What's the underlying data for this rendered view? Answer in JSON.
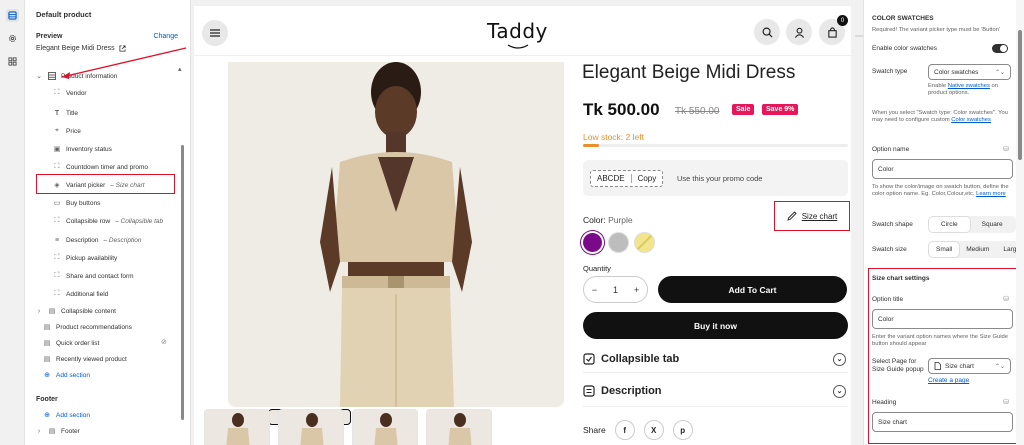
{
  "left_panel": {
    "header": "Default product",
    "preview_label": "Preview",
    "change_label": "Change",
    "preview_product": "Elegant Beige Midi Dress",
    "section_title": "Product information",
    "blocks": [
      {
        "label": "Vendor",
        "icon": "vendor-icon"
      },
      {
        "label": "Title",
        "icon": "text-icon"
      },
      {
        "label": "Price",
        "icon": "price-icon"
      },
      {
        "label": "Inventory status",
        "icon": "inventory-icon"
      },
      {
        "label": "Countdown timer and promo",
        "icon": "timer-icon"
      },
      {
        "label": "Variant picker",
        "sub": " – Size chart",
        "icon": "variant-icon"
      },
      {
        "label": "Buy buttons",
        "icon": "buy-icon"
      },
      {
        "label": "Collapsible row",
        "sub": " – Collapsible tab",
        "icon": "collapse-icon"
      },
      {
        "label": "Description",
        "sub": " – Description",
        "icon": "description-icon"
      },
      {
        "label": "Pickup availability",
        "icon": "pickup-icon"
      },
      {
        "label": "Share and contact form",
        "icon": "share-icon"
      },
      {
        "label": "Additional field",
        "icon": "field-icon"
      }
    ],
    "sections": [
      {
        "label": "Collapsible content"
      },
      {
        "label": "Product recommendations"
      },
      {
        "label": "Quick order list"
      },
      {
        "label": "Recently viewed product"
      }
    ],
    "add_section": "Add section",
    "footer_label": "Footer",
    "footer_add_section": "Add section",
    "footer_item": "Footer"
  },
  "store": {
    "logo": "Taddy",
    "cart_count": "0",
    "product_title": "Elegant Beige Midi Dress",
    "price": "Tk 500.00",
    "old_price": "Tk 550.00",
    "sale_badge": "Sale",
    "save_badge": "Save 9%",
    "low_stock": "Low stock: 2 left",
    "stock_fraction": 0.06,
    "promo_code": "ABCDE",
    "copy_label": "Copy",
    "promo_text": "Use this your promo code",
    "color_label": "Color:",
    "color_value": "Purple",
    "size_chart": "Size chart",
    "swatches": [
      "#7a0a8a",
      "#bdbdbd",
      "#f3e58a"
    ],
    "quantity_label": "Quantity",
    "quantity_value": "1",
    "add_to_cart": "Add To Cart",
    "buy_now": "Buy it now",
    "accordion_1": "Collapsible tab",
    "accordion_2": "Description",
    "share_label": "Share",
    "share_buttons": [
      "f",
      "X",
      "p"
    ]
  },
  "right_panel": {
    "heading": "COLOR SWATCHES",
    "required_note": "Required! The variant picker type must be 'Button'",
    "enable_label": "Enable color swatches",
    "swatch_type_label": "Swatch type",
    "swatch_type_value": "Color swatches",
    "enable_native_pre": "Enable",
    "enable_native_link": "Native swatches",
    "enable_native_post": "on product options.",
    "swatch_note": "When you select \"Swatch type: Color swatches\". You may need to configure custom",
    "color_swatches_link": "Color swatches",
    "option_name_label": "Option name",
    "option_name_value": "Color",
    "option_help": "To show the color/image on swatch button, define the color option name. Eg. Color,Colour,etc.",
    "learn_more": "Learn more",
    "swatch_shape_label": "Swatch shape",
    "shape_options": [
      "Circle",
      "Square"
    ],
    "swatch_size_label": "Swatch size",
    "size_options": [
      "Small",
      "Medium",
      "Large"
    ],
    "size_chart_heading": "Size chart settings",
    "option_title_label": "Option title",
    "option_title_value": "Color",
    "option_title_help": "Enter the variant option names where the Size Guide button should appear",
    "select_page_label": "Select Page for Size Guide popup",
    "select_page_value": "Size chart",
    "create_page": "Create a page",
    "heading_label": "Heading",
    "heading_value": "Size chart"
  },
  "accent_red": "#e0102a",
  "link_blue": "#005bd3"
}
